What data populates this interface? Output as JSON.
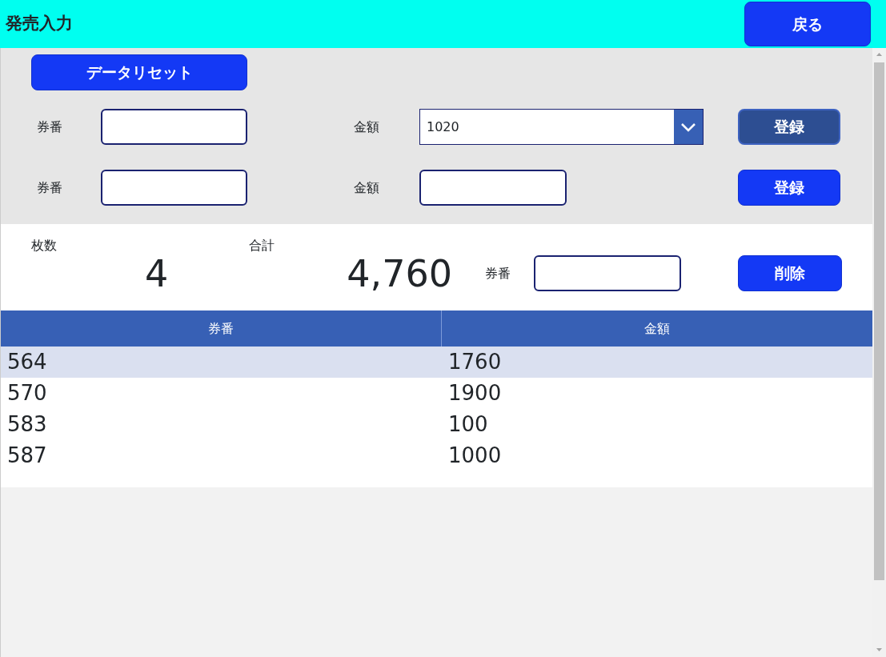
{
  "header": {
    "title": "発売入力",
    "back_button": "戻る"
  },
  "reset_button": "データリセット",
  "entry_rows": [
    {
      "ticket_label": "券番",
      "amount_label": "金額",
      "kind": "dropdown",
      "amount_value": "1020",
      "register_button": "登録",
      "register_disabled": true
    },
    {
      "ticket_label": "券番",
      "amount_label": "金額",
      "kind": "input",
      "register_button": "登録",
      "register_disabled": false
    }
  ],
  "summary": {
    "count_label": "枚数",
    "count": "4",
    "total_label": "合計",
    "total": "4,760",
    "ticket_label": "券番",
    "delete_button": "削除"
  },
  "table": {
    "columns": [
      "券番",
      "金額"
    ],
    "rows": [
      {
        "cells": [
          "564",
          "1760"
        ],
        "selected": true
      },
      {
        "cells": [
          "570",
          "1900"
        ],
        "selected": false
      },
      {
        "cells": [
          "583",
          "100"
        ],
        "selected": false
      },
      {
        "cells": [
          "587",
          "1000"
        ],
        "selected": false
      }
    ]
  }
}
